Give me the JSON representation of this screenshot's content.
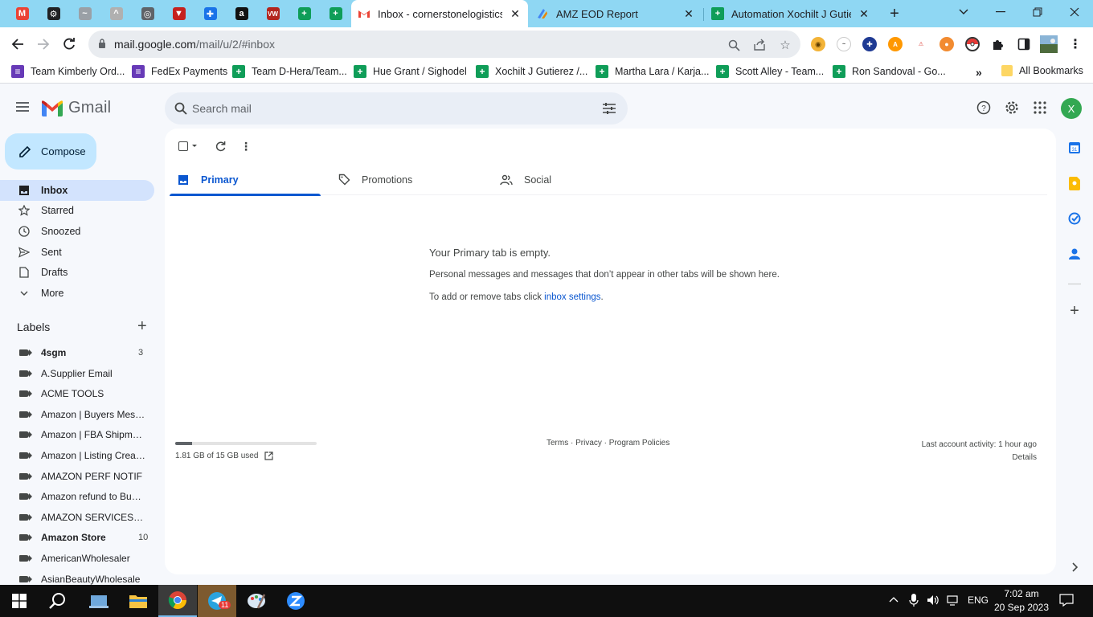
{
  "browser": {
    "pinned_tabs": [
      {
        "name": "gmail-pinned-tab",
        "color": "#ea4335",
        "glyph": "M"
      },
      {
        "name": "openai-pinned-tab",
        "color": "#202124",
        "glyph": "⚙"
      },
      {
        "name": "ext-pinned-tab-1",
        "color": "#9aa0a6",
        "glyph": "~"
      },
      {
        "name": "ext-pinned-tab-2",
        "color": "#b0b0b0",
        "glyph": "^"
      },
      {
        "name": "globe-pinned-tab",
        "color": "#5f6368",
        "glyph": "◎"
      },
      {
        "name": "ext-pinned-tab-3",
        "color": "#c5221f",
        "glyph": "▼"
      },
      {
        "name": "ext-pinned-tab-4",
        "color": "#1a73e8",
        "glyph": "✚"
      },
      {
        "name": "amazon-pinned-tab",
        "color": "#111111",
        "glyph": "a"
      },
      {
        "name": "vw-pinned-tab",
        "color": "#b3261e",
        "glyph": "VW"
      },
      {
        "name": "sheets-pinned-tab-1",
        "color": "#0f9d58",
        "glyph": "+"
      },
      {
        "name": "sheets-pinned-tab-2",
        "color": "#0f9d58",
        "glyph": "+"
      }
    ],
    "tabs": [
      {
        "title": "Inbox - cornerstonelogisticsll",
        "active": true
      },
      {
        "title": "AMZ EOD Report",
        "active": false
      },
      {
        "title": "Automation Xochilt J Gutierre",
        "active": false
      }
    ],
    "url_host": "mail.google.com",
    "url_path": "/mail/u/2/#inbox",
    "bookmarks": [
      {
        "label": "Team Kimberly Ord...",
        "type": "form"
      },
      {
        "label": "FedEx Payments",
        "type": "form"
      },
      {
        "label": "Team D-Hera/Team...",
        "type": "sheet"
      },
      {
        "label": "Hue Grant / Sighodel",
        "type": "sheet"
      },
      {
        "label": "Xochilt J Gutierez /...",
        "type": "sheet"
      },
      {
        "label": "Martha Lara / Karja...",
        "type": "sheet"
      },
      {
        "label": "Scott Alley - Team...",
        "type": "sheet"
      },
      {
        "label": "Ron Sandoval - Go...",
        "type": "sheet"
      }
    ],
    "all_bookmarks": "All Bookmarks"
  },
  "gmail": {
    "logo_text": "Gmail",
    "search_placeholder": "Search mail",
    "avatar_initial": "X",
    "compose": "Compose",
    "nav": [
      {
        "label": "Inbox",
        "icon": "inbox-icon",
        "active": true
      },
      {
        "label": "Starred",
        "icon": "star-icon",
        "active": false
      },
      {
        "label": "Snoozed",
        "icon": "clock-icon",
        "active": false
      },
      {
        "label": "Sent",
        "icon": "send-icon",
        "active": false
      },
      {
        "label": "Drafts",
        "icon": "draft-icon",
        "active": false
      },
      {
        "label": "More",
        "icon": "chevron-down-icon",
        "active": false
      }
    ],
    "labels_title": "Labels",
    "labels": [
      {
        "label": "4sgm",
        "count": "3",
        "bold": true
      },
      {
        "label": "A.Supplier Email",
        "count": "",
        "bold": false
      },
      {
        "label": "ACME TOOLS",
        "count": "",
        "bold": false
      },
      {
        "label": "Amazon | Buyers Messa...",
        "count": "",
        "bold": false
      },
      {
        "label": "Amazon | FBA Shipments",
        "count": "",
        "bold": false
      },
      {
        "label": "Amazon | Listing Created",
        "count": "",
        "bold": false
      },
      {
        "label": "AMAZON PERF NOTIF",
        "count": "",
        "bold": false
      },
      {
        "label": "Amazon refund to Buyers",
        "count": "",
        "bold": false
      },
      {
        "label": "AMAZON SERVICES/PAY...",
        "count": "",
        "bold": false
      },
      {
        "label": "Amazon Store",
        "count": "10",
        "bold": true
      },
      {
        "label": "AmericanWholesaler",
        "count": "",
        "bold": false
      },
      {
        "label": "AsianBeautyWholesale",
        "count": "",
        "bold": false
      }
    ],
    "category_tabs": [
      {
        "label": "Primary",
        "active": true
      },
      {
        "label": "Promotions",
        "active": false
      },
      {
        "label": "Social",
        "active": false
      }
    ],
    "empty_title": "Your Primary tab is empty.",
    "empty_desc": "Personal messages and messages that don’t appear in other tabs will be shown here.",
    "empty_add_prefix": "To add or remove tabs click ",
    "empty_add_link": "inbox settings",
    "empty_add_suffix": ".",
    "storage_text": "1.81 GB of 15 GB used",
    "storage_fraction": 0.12,
    "footer_links": "Terms · Privacy · Program Policies",
    "last_activity": "Last account activity: 1 hour ago",
    "details": "Details"
  },
  "taskbar": {
    "lang": "ENG",
    "time": "7:02 am",
    "date": "20 Sep 2023",
    "badge": "11"
  },
  "colors": {
    "accent": "#0b57d0",
    "compose_bg": "#c2e7ff",
    "active_nav": "#d3e3fd",
    "tabstrip": "#8fd7f3"
  }
}
